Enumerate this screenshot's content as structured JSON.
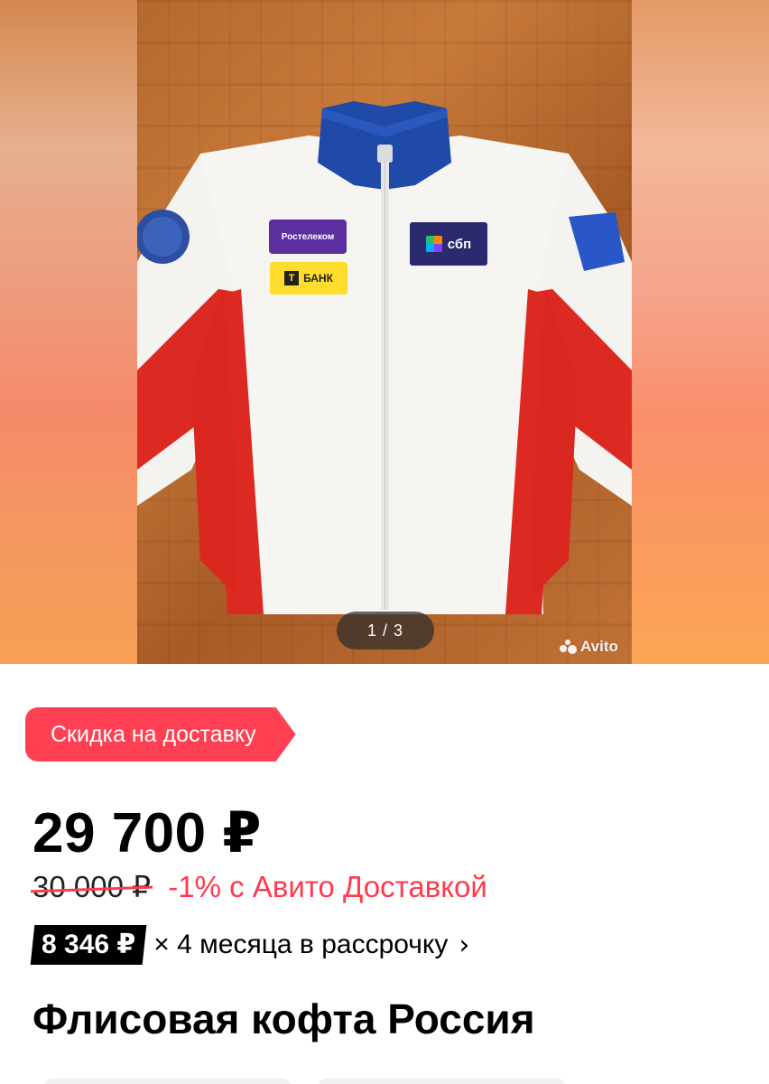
{
  "gallery": {
    "pager": "1 / 3",
    "watermark": "Avito",
    "patches": {
      "rostelecom": "Ростелеком",
      "tbank_letter": "Т",
      "tbank": "БАНК",
      "sbp": "сбп"
    }
  },
  "promo": {
    "label": "Скидка на доставку"
  },
  "price": {
    "current": "29 700 ₽",
    "old": "30 000 ₽",
    "discount": "-1% с Авито Доставкой"
  },
  "installment": {
    "amount": "8 346 ₽",
    "text": "× 4 месяца в рассрочку",
    "chevron": "›"
  },
  "product": {
    "title": "Флисовая кофта Россия"
  },
  "colors": {
    "accent": "#ff4053",
    "badge": "#000000"
  }
}
